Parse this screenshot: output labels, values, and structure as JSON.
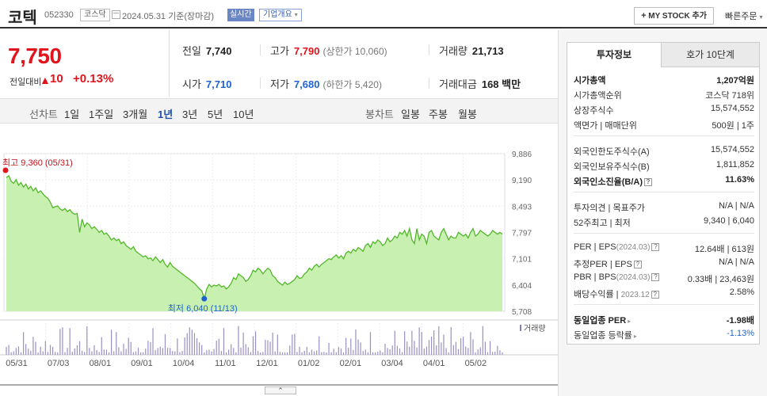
{
  "header": {
    "stock_name": "코텍",
    "stock_code": "052330",
    "market": "코스닥",
    "base_date": "2024.05.31 기준(장마감)",
    "realtime_label": "실시간",
    "company_overview_label": "기업개요",
    "mystock_label": "MY STOCK 추가",
    "quick_order_label": "빠른주문"
  },
  "price": {
    "current": "7,750",
    "change_label": "전일대비",
    "change_arrow": "▲",
    "change_amount": "10",
    "change_pct": "+0.13%"
  },
  "stats": {
    "prev_label": "전일",
    "prev": "7,740",
    "high_label": "고가",
    "high": "7,790",
    "upper_limit": "(상한가 10,060)",
    "volume_label": "거래량",
    "volume": "21,713",
    "open_label": "시가",
    "open": "7,710",
    "low_label": "저가",
    "low": "7,680",
    "lower_limit": "(하한가 5,420)",
    "amount_label": "거래대금",
    "amount": "168 백만"
  },
  "period_bar": {
    "line_chart_label": "선차트",
    "periods": [
      "1일",
      "1주일",
      "3개월",
      "1년",
      "3년",
      "5년",
      "10년"
    ],
    "active_period": "1년",
    "candle_chart_label": "봉차트",
    "candle_periods": [
      "일봉",
      "주봉",
      "월봉"
    ]
  },
  "chart_data": {
    "type": "area",
    "x_tick_labels": [
      "05/31",
      "07/03",
      "08/01",
      "09/01",
      "10/04",
      "11/01",
      "12/01",
      "01/02",
      "02/01",
      "03/04",
      "04/01",
      "05/02"
    ],
    "y_tick_labels": [
      "9,886",
      "9,190",
      "8,493",
      "7,797",
      "7,101",
      "6,404",
      "5,708"
    ],
    "ylim": [
      5708,
      9886
    ],
    "high_label": "최고 9,360 (05/31)",
    "low_label": "최저 6,040 (11/13)",
    "volume_legend": "거래량",
    "line_color": "#52b82a",
    "fill_color": "#c8f0b0",
    "series_values": [
      9250,
      9300,
      9150,
      9100,
      9200,
      9050,
      9120,
      9000,
      9080,
      8950,
      9020,
      8900,
      8980,
      8850,
      8900,
      8820,
      8750,
      8700,
      8600,
      8450,
      8480,
      8500,
      8420,
      8380,
      8430,
      8350,
      8400,
      8320,
      8280,
      8300,
      7800,
      8150,
      7950,
      8050,
      8000,
      7900,
      7950,
      7880,
      7800,
      7850,
      7750,
      7780,
      7700,
      7600,
      7650,
      7580,
      7620,
      7500,
      7550,
      7450,
      7400,
      7350,
      7420,
      7300,
      7250,
      7200,
      7150,
      7180,
      7100,
      7120,
      7050,
      7150,
      7080,
      7000,
      7080,
      6950,
      6880,
      7000,
      6900,
      6850,
      6800,
      6750,
      6700,
      6650,
      6600,
      6550,
      6500,
      6450,
      6380,
      6300,
      6250,
      6040,
      6300,
      6420,
      6350,
      6400,
      6380,
      6420,
      6350,
      6380,
      6300,
      6350,
      6450,
      6600,
      6550,
      6700,
      6650,
      6600,
      6500,
      6550,
      6650,
      6800,
      6750,
      6850,
      6800,
      6700,
      6780,
      6850,
      6800,
      6650,
      6600,
      6500,
      6450,
      6400,
      6480,
      6420,
      6450,
      6500,
      6550,
      6650,
      6580,
      6600,
      6700,
      6750,
      6850,
      6800,
      6900,
      6950,
      6880,
      6950,
      7000,
      7050,
      7100,
      7080,
      7150,
      7200,
      7120,
      7180,
      7100,
      7250,
      7300,
      7250,
      7350,
      7300,
      7400,
      7350,
      7300,
      7450,
      7500,
      7400,
      7550,
      7500,
      7600,
      7550,
      7450,
      7500,
      7650,
      7550,
      7600,
      7700,
      7650,
      7800,
      7750,
      7850,
      7700,
      7900,
      7600,
      7500,
      7900,
      7600,
      7750,
      7700,
      7500,
      7800,
      7850,
      7700,
      7650,
      7600,
      7800,
      7900,
      7750,
      7600,
      7700,
      7650,
      7650,
      7800,
      7750,
      7700,
      7750,
      7650,
      7800,
      7900,
      7700,
      7750,
      7850,
      7800,
      7750,
      7700,
      7750,
      7850,
      7800,
      7750,
      7800,
      7750
    ]
  },
  "right_panel": {
    "tab_active": "투자정보",
    "tab_inactive": "호가 10단계",
    "market_cap_label": "시가총액",
    "market_cap": "1,207억원",
    "market_cap_rank_label": "시가총액순위",
    "market_cap_rank": "코스닥 718위",
    "shares_label": "상장주식수",
    "shares": "15,574,552",
    "par_label": "액면가 | 매매단위",
    "par": "500원 | 1주",
    "foreign_limit_label": "외국인한도주식수(A)",
    "foreign_limit": "15,574,552",
    "foreign_hold_label": "외국인보유주식수(B)",
    "foreign_hold": "1,811,852",
    "foreign_ratio_label": "외국인소진율(B/A)",
    "foreign_ratio": "11.63%",
    "opinion_label": "투자의견 | 목표주가",
    "opinion": "N/A | N/A",
    "week52_label": "52주최고 | 최저",
    "week52": "9,340 | 6,040",
    "per_label": "PER | EPS",
    "per_date": "(2024.03)",
    "per": "12.64배 | 613원",
    "est_per_label": "추정PER | EPS",
    "est_per": "N/A | N/A",
    "pbr_label": "PBR | BPS",
    "pbr_date": "(2024.03)",
    "pbr": "0.33배 | 23,463원",
    "dividend_label": "배당수익률",
    "dividend_date": "2023.12",
    "dividend": "2.58%",
    "sector_per_label": "동일업종 PER",
    "sector_per": "-1.98배",
    "sector_change_label": "동일업종 등락률",
    "sector_change": "-1.13%"
  }
}
